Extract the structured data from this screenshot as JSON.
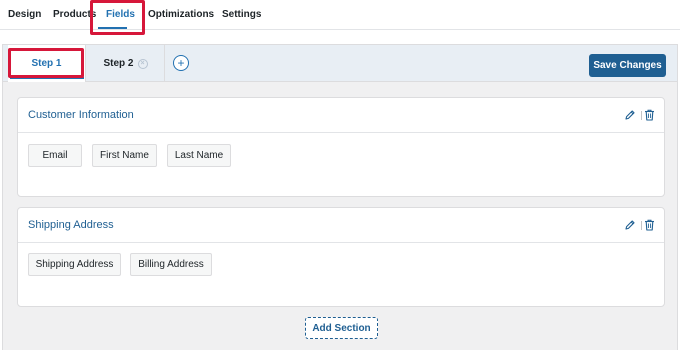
{
  "top_tabs": [
    {
      "label": "Design"
    },
    {
      "label": "Products"
    },
    {
      "label": "Fields"
    },
    {
      "label": "Optimizations"
    },
    {
      "label": "Settings"
    }
  ],
  "active_top_tab": "Fields",
  "steps": [
    {
      "label": "Step 1",
      "active": true
    },
    {
      "label": "Step 2",
      "active": false,
      "removable": true
    }
  ],
  "add_step_symbol": "+",
  "step_close_symbol": "×",
  "save_button_label": "Save Changes",
  "sections": [
    {
      "title": "Customer Information",
      "fields": [
        "Email",
        "First Name",
        "Last Name"
      ]
    },
    {
      "title": "Shipping Address",
      "fields": [
        "Shipping Address",
        "Billing Address"
      ]
    }
  ],
  "add_section_label": "Add Section",
  "icons": {
    "edit": "pencil-icon",
    "delete": "trash-icon",
    "add_step": "plus-circle-icon",
    "remove_step": "close-circle-icon"
  },
  "colors": {
    "accent": "#2271b1",
    "primary_button": "#1f5f92",
    "highlight": "#d6173a",
    "panel_bg": "#f0f0f1",
    "steps_bar_bg": "#e8eef4"
  }
}
